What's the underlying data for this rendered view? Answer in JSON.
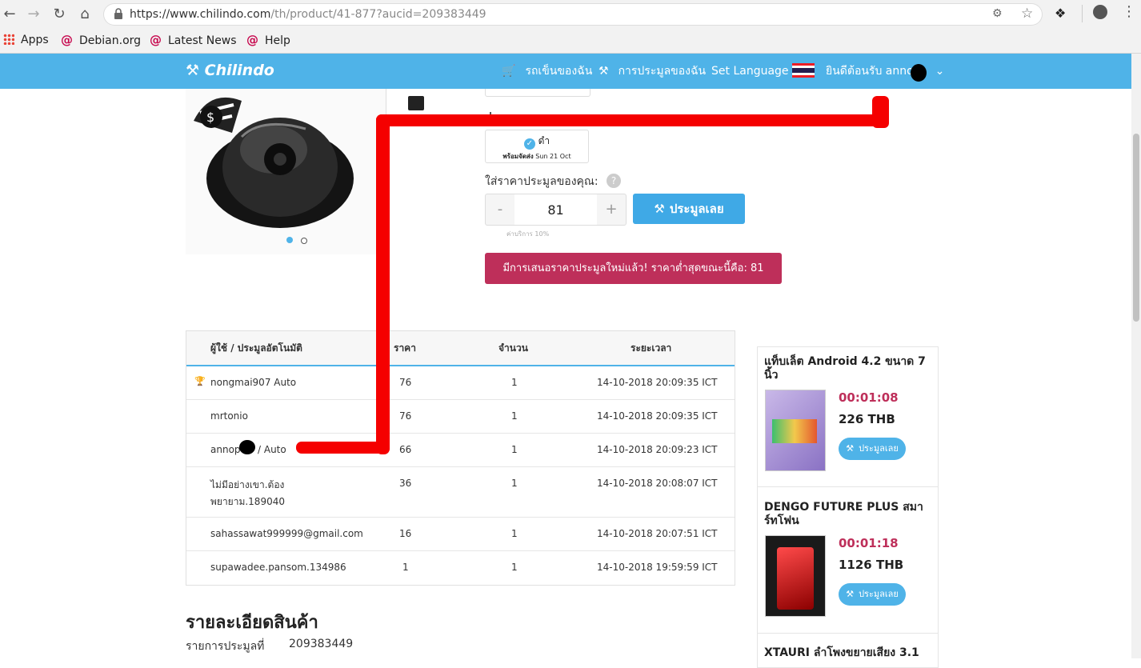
{
  "browser": {
    "url_host": "https://www.chilindo.com",
    "url_path": "/th/product/41-877?aucid=209383449",
    "bookmarks": [
      {
        "label": "Apps",
        "icon": "apps-grid-icon"
      },
      {
        "label": "Debian.org",
        "icon": "debian-swirl-icon"
      },
      {
        "label": "Latest News",
        "icon": "debian-swirl-icon"
      },
      {
        "label": "Help",
        "icon": "debian-swirl-icon"
      }
    ]
  },
  "header": {
    "logo": "Chilindo",
    "cart": "รถเข็นของฉัน",
    "my_bids": "การประมูลของฉัน",
    "language": "Set Language",
    "welcome": "ยินดีต้อนรับ annop"
  },
  "bid_panel": {
    "color_name": "ดำ",
    "ship_label": "พร้อมจัดส่ง",
    "ship_date": "Sun 21 Oct",
    "bid_label": "ใส่ราคาประมูลของคุณ:",
    "help": "?",
    "minus": "-",
    "plus": "+",
    "bid_value": "81",
    "fee_note": "ค่าบริการ 10%",
    "bid_button": "ประมูลเลย",
    "alert": "มีการเสนอราคาประมูลใหม่แล้ว! ราคาต่ำสุดขณะนี้คือ: 81"
  },
  "bid_table": {
    "headers": [
      "ผู้ใช้ / ประมูลอัตโนมัติ",
      "ราคา",
      "จำนวน",
      "ระยะเวลา"
    ],
    "rows": [
      {
        "user": "nongmai907 Auto",
        "price": "76",
        "qty": "1",
        "time": "14-10-2018 20:09:35 ICT",
        "winner": true
      },
      {
        "user": "mrtonio",
        "price": "76",
        "qty": "1",
        "time": "14-10-2018 20:09:35 ICT"
      },
      {
        "user": "annop",
        "user_suffix": "/ Auto",
        "price": "66",
        "qty": "1",
        "time": "14-10-2018 20:09:23 ICT"
      },
      {
        "user": "ไม่มีอย่างเขา.ต้อง",
        "user2": "พยายาม.189040",
        "price": "36",
        "qty": "1",
        "time": "14-10-2018 20:08:07 ICT"
      },
      {
        "user": "sahassawat999999@gmail.com",
        "price": "16",
        "qty": "1",
        "time": "14-10-2018 20:07:51 ICT"
      },
      {
        "user": "supawadee.pansom.134986",
        "price": "1",
        "qty": "1",
        "time": "14-10-2018 19:59:59 ICT"
      }
    ]
  },
  "details": {
    "title": "รายละเอียดสินค้า",
    "auction_no_label": "รายการประมูลที่",
    "auction_no": "209383449"
  },
  "side_auctions": [
    {
      "title": "แท็บเล็ต Android 4.2 ขนาด 7 นิ้ว",
      "timer": "00:01:08",
      "price": "226 THB",
      "button": "ประมูลเลย"
    },
    {
      "title": "DENGO FUTURE PLUS สมาร์ทโฟน",
      "timer": "00:01:18",
      "price": "1126 THB",
      "button": "ประมูลเลย"
    },
    {
      "title": "XTAURI ลำโพงขยายเสียง 3.1",
      "timer": "",
      "price": "",
      "button": ""
    }
  ],
  "colors": {
    "brand_blue": "#4fb3e8",
    "alert": "#be2f5a",
    "annotation": "#f50000"
  }
}
